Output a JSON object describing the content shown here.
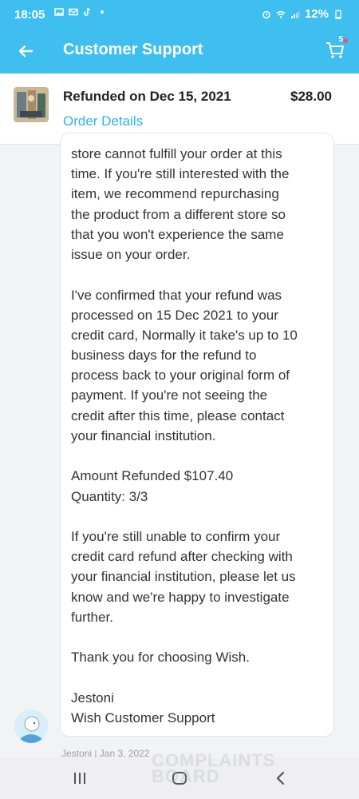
{
  "status_bar": {
    "time": "18:05",
    "battery": "12%",
    "left_icons": [
      "image-icon",
      "mail-icon",
      "tiktok-icon",
      "dot-icon"
    ],
    "right_icons": [
      "alarm-icon",
      "wifi-icon",
      "signal-icon",
      "battery-icon"
    ]
  },
  "app_bar": {
    "title": "Customer Support",
    "cart_count": "5",
    "accent": "#3fbef0"
  },
  "order": {
    "status": "Refunded on Dec 15, 2021",
    "price": "$28.00",
    "details_link": "Order Details",
    "link_color": "#2fb2e6"
  },
  "message": {
    "lines": [
      "store cannot fulfill your order at this",
      "time. If you're still interested with the",
      "item, we recommend repurchasing",
      "the product from a different store so",
      "that you won't experience the same",
      "issue on your order.",
      "I've confirmed that your refund was",
      "processed on 15 Dec 2021 to your",
      "credit card, Normally it take's up to 10",
      "business days for the refund to",
      "process back to your original form of",
      "payment. If you're not seeing the",
      "credit after this time, please contact",
      "your financial institution.",
      "Amount Refunded $107.40",
      "Quantity: 3/3",
      "If you're still unable to confirm your",
      "credit card refund after checking with",
      "your financial institution, please let us",
      "know and we're happy to investigate",
      "further.",
      "Thank you for choosing Wish.",
      "Jestoni",
      "Wish Customer Support"
    ],
    "meta": "Jestoni | Jan 3, 2022"
  },
  "watermark": {
    "line1": "COMPLAINTS",
    "line2": "BOARD"
  }
}
